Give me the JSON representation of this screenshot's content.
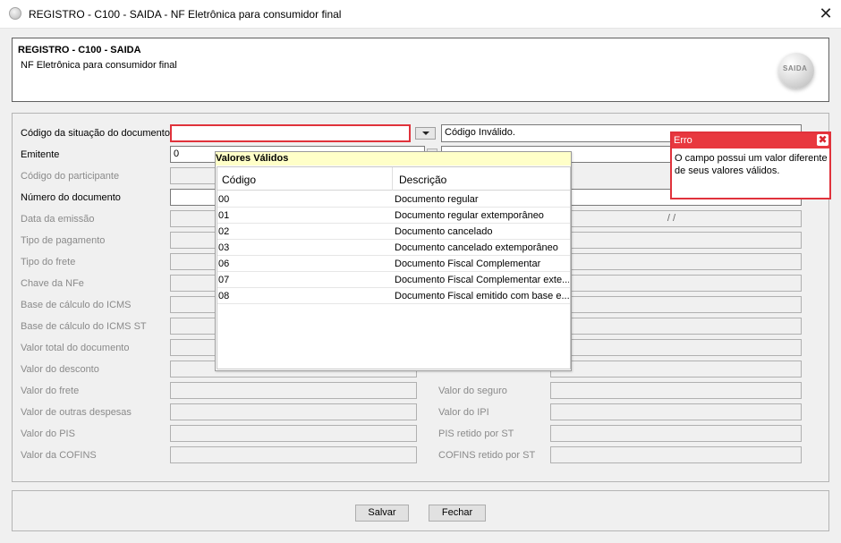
{
  "window": {
    "title": "REGISTRO - C100 - SAIDA - NF Eletrônica para consumidor final"
  },
  "header": {
    "title": "REGISTRO - C100 - SAIDA",
    "subtitle": "NF Eletrônica para consumidor final",
    "logo_text": "SAIDA"
  },
  "form": {
    "codigo_situacao": {
      "label": "Código da situação do documento",
      "value": "",
      "description": "Código Inválido."
    },
    "emitente": {
      "label": "Emitente",
      "value": "0"
    },
    "codigo_participante": {
      "label": "Código do participante"
    },
    "numero_documento": {
      "label": "Número do documento"
    },
    "data_emissao": {
      "label": "Data da emissão",
      "right_value": "/  /"
    },
    "tipo_pagamento": {
      "label": "Tipo de pagamento"
    },
    "tipo_frete": {
      "label": "Tipo do frete"
    },
    "chave_nfe": {
      "label": "Chave da NFe"
    },
    "base_icms": {
      "label": "Base de cálculo do ICMS"
    },
    "base_icms_st": {
      "label": "Base de cálculo do ICMS ST"
    },
    "valor_total": {
      "label": "Valor total do documento"
    },
    "valor_desconto": {
      "label": "Valor do desconto"
    },
    "valor_frete": {
      "label": "Valor do frete"
    },
    "valor_outras": {
      "label": "Valor de outras despesas"
    },
    "valor_pis": {
      "label": "Valor do PIS"
    },
    "valor_cofins": {
      "label": "Valor da COFINS"
    },
    "valor_seguro": {
      "label": "Valor do seguro"
    },
    "valor_ipi": {
      "label": "Valor do IPI"
    },
    "pis_retido_st": {
      "label": "PIS retido por ST"
    },
    "cofins_retido_st": {
      "label": "COFINS retido por ST"
    }
  },
  "valid_values": {
    "title": "Valores Válidos",
    "columns": [
      "Código",
      "Descrição"
    ],
    "rows": [
      {
        "code": "00",
        "desc": "Documento regular"
      },
      {
        "code": "01",
        "desc": "Documento regular extemporâneo"
      },
      {
        "code": "02",
        "desc": "Documento cancelado"
      },
      {
        "code": "03",
        "desc": "Documento cancelado extemporâneo"
      },
      {
        "code": "06",
        "desc": "Documento Fiscal Complementar"
      },
      {
        "code": "07",
        "desc": "Documento Fiscal Complementar exte..."
      },
      {
        "code": "08",
        "desc": "Documento Fiscal emitido com base e..."
      }
    ]
  },
  "error": {
    "title": "Erro",
    "message": "O campo possui um valor diferente de seus valores válidos."
  },
  "buttons": {
    "save": "Salvar",
    "close": "Fechar"
  },
  "colors": {
    "error_red": "#e0323b",
    "popup_title_bg": "#ffffc8"
  }
}
